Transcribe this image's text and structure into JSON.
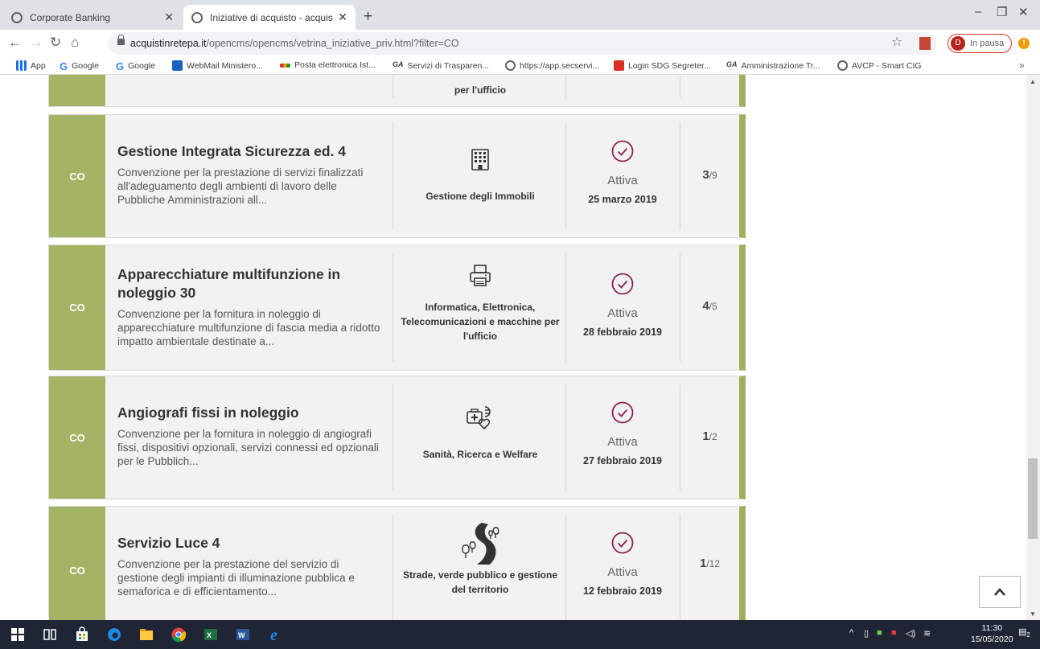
{
  "browser": {
    "tabs": [
      {
        "title": "Corporate Banking",
        "active": false
      },
      {
        "title": "Iniziative di acquisto - acquistinre",
        "active": true
      }
    ],
    "url_host": "acquistinretepa.it",
    "url_path": "/opencms/opencms/vetrina_iniziative_priv.html?filter=CO",
    "profile_initial": "D",
    "profile_label": "In pausa",
    "bookmarks": [
      {
        "label": "App",
        "icon": "apps-grid-icon"
      },
      {
        "label": "Google",
        "icon": "google-icon"
      },
      {
        "label": "Google",
        "icon": "google-icon"
      },
      {
        "label": "WebMail Ministero...",
        "icon": "webmail-icon"
      },
      {
        "label": "Posta elettronica Ist...",
        "icon": "mail-icon"
      },
      {
        "label": "Servizi di Trasparen...",
        "icon": "ga-icon"
      },
      {
        "label": "https://app.secservi...",
        "icon": "globe-icon"
      },
      {
        "label": "Login SDG Segreter...",
        "icon": "sdg-icon"
      },
      {
        "label": "Amministrazione Tr...",
        "icon": "ga-icon"
      },
      {
        "label": "AVCP - Smart CIG",
        "icon": "globe-icon"
      }
    ]
  },
  "partial_card": {
    "category_line": "per l'ufficio"
  },
  "initiatives": [
    {
      "tag": "CO",
      "title": "Gestione Integrata Sicurezza ed. 4",
      "description": "Convenzione per la prestazione di servizi finalizzati all'adeguamento degli ambienti di lavoro delle Pubbliche Amministrazioni all...",
      "category": "Gestione degli Immobili",
      "category_icon": "building-icon",
      "status": "Attiva",
      "date": "25 marzo 2019",
      "count_current": "3",
      "count_total": "/9"
    },
    {
      "tag": "CO",
      "title": "Apparecchiature multifunzione in noleggio 30",
      "description": "Convenzione per la fornitura in noleggio di apparecchiature multifunzione di fascia media a ridotto impatto ambientale destinate a...",
      "category": "Informatica, Elettronica, Telecomunicazioni e macchine per l'ufficio",
      "category_icon": "printer-icon",
      "status": "Attiva",
      "date": "28 febbraio 2019",
      "count_current": "4",
      "count_total": "/5"
    },
    {
      "tag": "CO",
      "title": "Angiografi fissi in noleggio",
      "description": "Convenzione per la fornitura in noleggio di angiografi fissi, dispositivi opzionali, servizi connessi ed opzionali per le Pubblich...",
      "category": "Sanità, Ricerca e Welfare",
      "category_icon": "health-icon",
      "status": "Attiva",
      "date": "27 febbraio 2019",
      "count_current": "1",
      "count_total": "/2"
    },
    {
      "tag": "CO",
      "title": "Servizio Luce 4",
      "description": "Convenzione per la prestazione del servizio di gestione degli impianti di illuminazione pubblica e semaforica e di efficientamento...",
      "category": "Strade, verde pubblico e gestione del territorio",
      "category_icon": "road-trees-icon",
      "status": "Attiva",
      "date": "12 febbraio 2019",
      "count_current": "1",
      "count_total": "/12"
    }
  ],
  "taskbar": {
    "time": "11:30",
    "date": "15/05/2020",
    "notifications": "2"
  },
  "colors": {
    "accent_green": "#a4b465",
    "status_purple": "#8b2252"
  }
}
